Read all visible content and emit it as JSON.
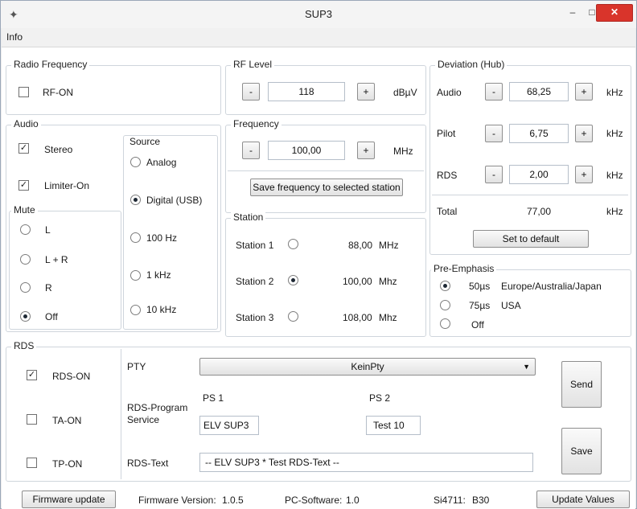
{
  "window": {
    "title": "SUP3",
    "min": "–",
    "max": "□",
    "close": "✕"
  },
  "menu": {
    "info": "Info"
  },
  "radio_frequency": {
    "legend": "Radio Frequency",
    "rf_on": {
      "label": "RF-ON",
      "checked": false
    }
  },
  "rf_level": {
    "legend": "RF Level",
    "minus": "-",
    "plus": "+",
    "value": "118",
    "unit": "dBµV"
  },
  "audio": {
    "legend": "Audio",
    "stereo": {
      "label": "Stereo",
      "checked": true
    },
    "limiter": {
      "label": "Limiter-On",
      "checked": true
    },
    "mute": {
      "legend": "Mute",
      "options": [
        "L",
        "L + R",
        "R",
        "Off"
      ],
      "selected": "Off"
    },
    "source": {
      "legend": "Source",
      "options": [
        "Analog",
        "Digital (USB)",
        "100 Hz",
        "1 kHz",
        "10 kHz"
      ],
      "selected": "Digital (USB)"
    }
  },
  "frequency": {
    "legend": "Frequency",
    "minus": "-",
    "plus": "+",
    "value": "100,00",
    "unit": "MHz",
    "save_label": "Save frequency to selected station"
  },
  "station": {
    "legend": "Station",
    "items": [
      {
        "name": "Station 1",
        "freq": "88,00",
        "unit": "MHz",
        "selected": false
      },
      {
        "name": "Station 2",
        "freq": "100,00",
        "unit": "Mhz",
        "selected": true
      },
      {
        "name": "Station 3",
        "freq": "108,00",
        "unit": "Mhz",
        "selected": false
      }
    ]
  },
  "deviation": {
    "legend": "Deviation (Hub)",
    "rows": [
      {
        "label": "Audio",
        "value": "68,25",
        "unit": "kHz"
      },
      {
        "label": "Pilot",
        "value": "6,75",
        "unit": "kHz"
      },
      {
        "label": "RDS",
        "value": "2,00",
        "unit": "kHz"
      }
    ],
    "minus": "-",
    "plus": "+",
    "total_label": "Total",
    "total_value": "77,00",
    "total_unit": "kHz",
    "default_label": "Set to default"
  },
  "pre_emphasis": {
    "legend": "Pre-Emphasis",
    "options": [
      {
        "value": "50µs",
        "region": "Europe/Australia/Japan",
        "selected": true
      },
      {
        "value": "75µs",
        "region": "USA",
        "selected": false
      },
      {
        "value": "Off",
        "region": "",
        "selected": false
      }
    ]
  },
  "rds": {
    "legend": "RDS",
    "rds_on": {
      "label": "RDS-ON",
      "checked": true
    },
    "ta_on": {
      "label": "TA-ON",
      "checked": false
    },
    "tp_on": {
      "label": "TP-ON",
      "checked": false
    },
    "pty_label": "PTY",
    "pty_value": "KeinPty",
    "ps_label_1": "RDS-Program",
    "ps_label_2": "Service",
    "ps1_label": "PS 1",
    "ps1_value": "ELV SUP3",
    "ps2_label": "PS 2",
    "ps2_value": "Test 10",
    "text_label": "RDS-Text",
    "text_value": "-- ELV SUP3 * Test RDS-Text --",
    "send_label": "Send",
    "save_label": "Save"
  },
  "statusbar": {
    "firmware_update": "Firmware update",
    "fw_label": "Firmware Version:",
    "fw_value": "1.0.5",
    "pc_label": "PC-Software:",
    "pc_value": "1.0",
    "si_label": "Si4711:",
    "si_value": "B30",
    "update_values": "Update Values"
  }
}
